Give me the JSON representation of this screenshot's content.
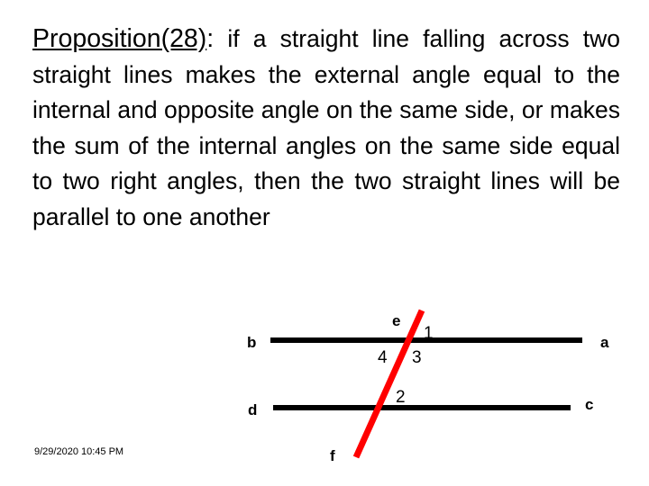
{
  "slide": {
    "background_color": "#ffffff",
    "text_color": "#000000"
  },
  "proposition": {
    "title": "Proposition(28)",
    "colon": ":",
    "body": " if a straight line falling across two straight lines makes the external angle equal to the internal and opposite angle on the same side, or makes the sum of the internal angles on the same side equal to two right angles, then the two straight lines will be parallel to one another"
  },
  "diagram": {
    "line_color": "#000000",
    "transversal_color": "#ff0000",
    "labels": {
      "b": "b",
      "a": "a",
      "d": "d",
      "c": "c",
      "e": "e",
      "f": "f",
      "angle1": "1",
      "angle2": "2",
      "angle3": "3",
      "angle4": "4"
    }
  },
  "footer": {
    "timestamp": "9/29/2020 10:45 PM"
  }
}
